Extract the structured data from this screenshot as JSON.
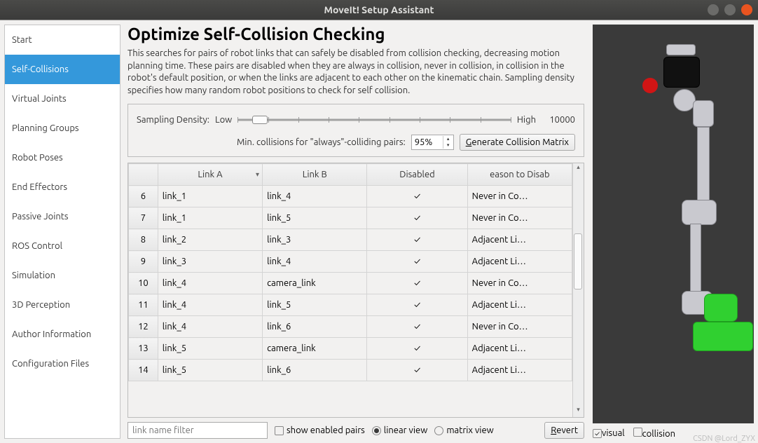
{
  "window": {
    "title": "MoveIt! Setup Assistant"
  },
  "sidebar": {
    "items": [
      "Start",
      "Self-Collisions",
      "Virtual Joints",
      "Planning Groups",
      "Robot Poses",
      "End Effectors",
      "Passive Joints",
      "ROS Control",
      "Simulation",
      "3D Perception",
      "Author Information",
      "Configuration Files"
    ],
    "active_index": 1
  },
  "header": {
    "title": "Optimize Self-Collision Checking",
    "desc": "This searches for pairs of robot links that can safely be disabled from collision checking, decreasing motion planning time. These pairs are disabled when they are always in collision, never in collision, in collision in the robot's default position, or when the links are adjacent to each other on the kinematic chain. Sampling density specifies how many random robot positions to check for self collision."
  },
  "density": {
    "label": "Sampling Density:",
    "low": "Low",
    "high": "High",
    "value": "10000",
    "min_label": "Min. collisions for \"always\"-colliding pairs:",
    "pct": "95%",
    "generate": "enerate Collision Matrix",
    "generate_ul": "G"
  },
  "table": {
    "cols": [
      "",
      "Link A",
      "Link B",
      "Disabled",
      "eason to Disab"
    ],
    "rows": [
      {
        "n": "6",
        "a": "link_1",
        "b": "link_4",
        "d": true,
        "r": "Never in Co…"
      },
      {
        "n": "7",
        "a": "link_1",
        "b": "link_5",
        "d": true,
        "r": "Never in Co…"
      },
      {
        "n": "8",
        "a": "link_2",
        "b": "link_3",
        "d": true,
        "r": "Adjacent Li…"
      },
      {
        "n": "9",
        "a": "link_3",
        "b": "link_4",
        "d": true,
        "r": "Adjacent Li…"
      },
      {
        "n": "10",
        "a": "link_4",
        "b": "camera_link",
        "d": true,
        "r": "Never in Co…"
      },
      {
        "n": "11",
        "a": "link_4",
        "b": "link_5",
        "d": true,
        "r": "Adjacent Li…"
      },
      {
        "n": "12",
        "a": "link_4",
        "b": "link_6",
        "d": true,
        "r": "Never in Co…"
      },
      {
        "n": "13",
        "a": "link_5",
        "b": "camera_link",
        "d": true,
        "r": "Adjacent Li…"
      },
      {
        "n": "14",
        "a": "link_5",
        "b": "link_6",
        "d": true,
        "r": "Adjacent Li…"
      }
    ]
  },
  "footer": {
    "filter_placeholder": "link name filter",
    "show_enabled": "show enabled pairs",
    "linear": "linear view",
    "matrix": "matrix view",
    "revert": "evert",
    "revert_ul": "R"
  },
  "right": {
    "visual": "visual",
    "collision": "collision"
  },
  "watermark": "CSDN @Lord_ZYX"
}
